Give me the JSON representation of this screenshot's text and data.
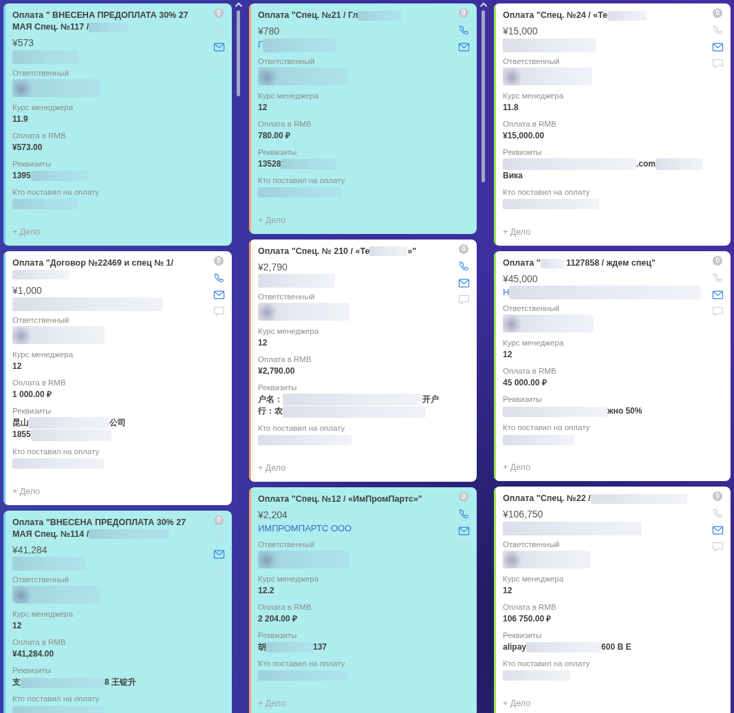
{
  "columns": [
    {
      "color": "#6fcbef",
      "scrollbar": true,
      "cards": [
        {
          "highlighted": true,
          "title": [
            {
              "kind": "text",
              "text": "Оплата \" ВНЕСЕНА ПРЕДОПЛАТА 30% 27 МАЯ Спец. №117 /"
            },
            {
              "kind": "redacted"
            }
          ],
          "badge": "0",
          "actions": [
            {
              "kind": "phone",
              "active": false
            },
            {
              "kind": "email",
              "active": true
            },
            {
              "kind": "chat",
              "active": false
            }
          ],
          "amount": "¥573",
          "company": [
            {
              "kind": "redacted"
            }
          ],
          "fields": [
            {
              "label": "Ответственный",
              "value": [
                {
                  "kind": "redacted"
                }
              ]
            },
            {
              "label": "Курс менеджера",
              "value": [
                {
                  "kind": "text",
                  "text": "11.9"
                }
              ]
            },
            {
              "label": "Оплата в RMB",
              "value": [
                {
                  "kind": "text",
                  "text": "¥573.00"
                }
              ]
            },
            {
              "label": "Реквизиты",
              "value": [
                {
                  "kind": "text",
                  "text": "1395"
                },
                {
                  "kind": "redacted"
                }
              ]
            },
            {
              "label": "Кто поставил на оплату",
              "value": [
                {
                  "kind": "redacted"
                }
              ]
            }
          ],
          "add_task": "+ Дело"
        },
        {
          "highlighted": false,
          "title": [
            {
              "kind": "text",
              "text": "Оплата \"Договор №22469 и спец № 1/"
            },
            {
              "kind": "break"
            },
            {
              "kind": "redacted"
            }
          ],
          "badge": "0",
          "actions": [
            {
              "kind": "phone",
              "active": true
            },
            {
              "kind": "email",
              "active": true
            },
            {
              "kind": "chat",
              "active": false
            }
          ],
          "amount": "¥1,000",
          "company": [
            {
              "kind": "redacted"
            }
          ],
          "fields": [
            {
              "label": "Ответственный",
              "value": [
                {
                  "kind": "redacted"
                }
              ]
            },
            {
              "label": "Курс менеджера",
              "value": [
                {
                  "kind": "text",
                  "text": "12"
                }
              ]
            },
            {
              "label": "Оплата в RMB",
              "value": [
                {
                  "kind": "text",
                  "text": "1 000.00 ₽"
                }
              ]
            },
            {
              "label": "Реквизиты",
              "value": [
                {
                  "kind": "text",
                  "text": "昆山"
                },
                {
                  "kind": "redacted"
                },
                {
                  "kind": "text",
                  "text": "公司"
                },
                {
                  "kind": "break"
                },
                {
                  "kind": "text",
                  "text": "1855"
                },
                {
                  "kind": "redacted"
                }
              ]
            },
            {
              "label": "Кто поставил на оплату",
              "value": [
                {
                  "kind": "redacted"
                }
              ]
            }
          ],
          "add_task": "+ Дело"
        },
        {
          "highlighted": true,
          "title": [
            {
              "kind": "text",
              "text": "Оплата \"ВНЕСЕНА ПРЕДОПЛАТА 30% 27 МАЯ Спец. №114 /"
            },
            {
              "kind": "redacted"
            }
          ],
          "badge": "0",
          "actions": [
            {
              "kind": "phone",
              "active": false
            },
            {
              "kind": "email",
              "active": true
            },
            {
              "kind": "chat",
              "active": false
            }
          ],
          "amount": "¥41,284",
          "company": [
            {
              "kind": "redacted"
            }
          ],
          "fields": [
            {
              "label": "Ответственный",
              "value": [
                {
                  "kind": "redacted"
                }
              ]
            },
            {
              "label": "Курс менеджера",
              "value": [
                {
                  "kind": "text",
                  "text": "12"
                }
              ]
            },
            {
              "label": "Оплата в RMB",
              "value": [
                {
                  "kind": "text",
                  "text": "¥41,284.00"
                }
              ]
            },
            {
              "label": "Реквизиты",
              "value": [
                {
                  "kind": "text",
                  "text": "支"
                },
                {
                  "kind": "redacted"
                },
                {
                  "kind": "text",
                  "text": "8 王锭升"
                }
              ]
            },
            {
              "label": "Кто поставил на оплату",
              "value": [
                {
                  "kind": "redacted"
                }
              ]
            }
          ]
        }
      ]
    },
    {
      "color": "#f4a36c",
      "scrollbar": true,
      "cards": [
        {
          "highlighted": true,
          "title": [
            {
              "kind": "text",
              "text": "Оплата \"Спец. №21 / Гл"
            },
            {
              "kind": "redacted"
            }
          ],
          "badge": "0",
          "actions": [
            {
              "kind": "phone",
              "active": true
            },
            {
              "kind": "email",
              "active": true
            },
            {
              "kind": "chat",
              "active": false
            }
          ],
          "amount": "¥780",
          "company": [
            {
              "kind": "text",
              "text": "Г"
            },
            {
              "kind": "redacted"
            }
          ],
          "fields": [
            {
              "label": "Ответственный",
              "value": [
                {
                  "kind": "redacted"
                }
              ]
            },
            {
              "label": "Курс менеджера",
              "value": [
                {
                  "kind": "text",
                  "text": "12"
                }
              ]
            },
            {
              "label": "Оплата в RMB",
              "value": [
                {
                  "kind": "text",
                  "text": "780.00 ₽"
                }
              ]
            },
            {
              "label": "Реквизиты",
              "value": [
                {
                  "kind": "text",
                  "text": "13528"
                },
                {
                  "kind": "redacted"
                }
              ]
            },
            {
              "label": "Кто поставил на оплату",
              "value": [
                {
                  "kind": "redacted"
                }
              ]
            }
          ],
          "add_task": "+ Дело"
        },
        {
          "highlighted": false,
          "title": [
            {
              "kind": "text",
              "text": "Оплата \"Спец. № 210 / «Те"
            },
            {
              "kind": "redacted"
            },
            {
              "kind": "text",
              "text": "»\""
            }
          ],
          "badge": "0",
          "actions": [
            {
              "kind": "phone",
              "active": true
            },
            {
              "kind": "email",
              "active": true
            },
            {
              "kind": "chat",
              "active": false
            }
          ],
          "amount": "¥2,790",
          "company": [
            {
              "kind": "redacted"
            }
          ],
          "fields": [
            {
              "label": "Ответственный",
              "value": [
                {
                  "kind": "redacted"
                }
              ]
            },
            {
              "label": "Курс менеджера",
              "value": [
                {
                  "kind": "text",
                  "text": "12"
                }
              ]
            },
            {
              "label": "Оплата в RMB",
              "value": [
                {
                  "kind": "text",
                  "text": "¥2,790.00"
                }
              ]
            },
            {
              "label": "Реквизиты",
              "value": [
                {
                  "kind": "text",
                  "text": "户名："
                },
                {
                  "kind": "redacted"
                },
                {
                  "kind": "text",
                  "text": "开户"
                },
                {
                  "kind": "break"
                },
                {
                  "kind": "text",
                  "text": "行：农"
                },
                {
                  "kind": "redacted"
                }
              ]
            },
            {
              "label": "Кто поставил на оплату",
              "value": [
                {
                  "kind": "redacted"
                }
              ]
            }
          ],
          "add_task": "+ Дело"
        },
        {
          "highlighted": true,
          "title": [
            {
              "kind": "text",
              "text": "Оплата \"Спец. №12 / «ИмПромПартс»\""
            }
          ],
          "badge": "0",
          "actions": [
            {
              "kind": "phone",
              "active": true
            },
            {
              "kind": "email",
              "active": true
            },
            {
              "kind": "chat",
              "active": false
            }
          ],
          "amount": "¥2,204",
          "company": [
            {
              "kind": "text",
              "text": "ИМПРОМПАРТС ООО"
            }
          ],
          "fields": [
            {
              "label": "Ответственный",
              "value": [
                {
                  "kind": "redacted"
                }
              ]
            },
            {
              "label": "Курс менеджера",
              "value": [
                {
                  "kind": "text",
                  "text": "12.2"
                }
              ]
            },
            {
              "label": "Оплата в RMB",
              "value": [
                {
                  "kind": "text",
                  "text": "2 204.00 ₽"
                }
              ]
            },
            {
              "label": "Реквизиты",
              "value": [
                {
                  "kind": "text",
                  "text": "胡"
                },
                {
                  "kind": "redacted"
                },
                {
                  "kind": "text",
                  "text": "137"
                }
              ]
            },
            {
              "label": "Кто поставил на оплату",
              "value": [
                {
                  "kind": "redacted"
                }
              ]
            }
          ],
          "add_task": "+ Дело"
        }
      ]
    },
    {
      "color": "#9fe650",
      "cards": [
        {
          "highlighted": false,
          "title": [
            {
              "kind": "text",
              "text": "Оплата \"Спец. №24 / «Те"
            },
            {
              "kind": "redacted"
            }
          ],
          "badge": "0",
          "actions": [
            {
              "kind": "phone",
              "active": false
            },
            {
              "kind": "email",
              "active": true
            },
            {
              "kind": "chat",
              "active": false
            }
          ],
          "amount": "¥15,000",
          "company": [
            {
              "kind": "redacted"
            }
          ],
          "fields": [
            {
              "label": "Ответственный",
              "value": [
                {
                  "kind": "redacted"
                }
              ]
            },
            {
              "label": "Курс менеджера",
              "value": [
                {
                  "kind": "text",
                  "text": "11.8"
                }
              ]
            },
            {
              "label": "Оплата в RMB",
              "value": [
                {
                  "kind": "text",
                  "text": "¥15,000.00"
                }
              ]
            },
            {
              "label": "Реквизиты",
              "value": [
                {
                  "kind": "redacted"
                },
                {
                  "kind": "text",
                  "text": ".com"
                },
                {
                  "kind": "redacted"
                },
                {
                  "kind": "break"
                },
                {
                  "kind": "text",
                  "text": "Вика"
                }
              ]
            },
            {
              "label": "Кто поставил на оплату",
              "value": [
                {
                  "kind": "redacted"
                }
              ]
            }
          ],
          "add_task": "+ Дело"
        },
        {
          "highlighted": false,
          "title": [
            {
              "kind": "text",
              "text": "Оплата \""
            },
            {
              "kind": "redacted"
            },
            {
              "kind": "text",
              "text": " 1127858 / ждем спец\""
            }
          ],
          "badge": "0",
          "actions": [
            {
              "kind": "phone",
              "active": false
            },
            {
              "kind": "email",
              "active": true
            },
            {
              "kind": "chat",
              "active": false
            }
          ],
          "amount": "¥45,000",
          "company": [
            {
              "kind": "text",
              "text": "Н"
            },
            {
              "kind": "redacted"
            }
          ],
          "fields": [
            {
              "label": "Ответственный",
              "value": [
                {
                  "kind": "redacted"
                }
              ]
            },
            {
              "label": "Курс менеджера",
              "value": [
                {
                  "kind": "text",
                  "text": "12"
                }
              ]
            },
            {
              "label": "Оплата в RMB",
              "value": [
                {
                  "kind": "text",
                  "text": "45 000.00 ₽"
                }
              ]
            },
            {
              "label": "Реквизиты",
              "value": [
                {
                  "kind": "redacted"
                },
                {
                  "kind": "text",
                  "text": "жно 50%"
                }
              ]
            },
            {
              "label": "Кто поставил на оплату",
              "value": [
                {
                  "kind": "redacted"
                }
              ]
            }
          ],
          "add_task": "+ Дело"
        },
        {
          "highlighted": false,
          "title": [
            {
              "kind": "text",
              "text": "Оплата \"Спец. №22 /"
            },
            {
              "kind": "redacted"
            }
          ],
          "badge": "0",
          "actions": [
            {
              "kind": "phone",
              "active": false
            },
            {
              "kind": "email",
              "active": true
            },
            {
              "kind": "chat",
              "active": false
            }
          ],
          "amount": "¥106,750",
          "company": [
            {
              "kind": "redacted"
            }
          ],
          "fields": [
            {
              "label": "Ответственный",
              "value": [
                {
                  "kind": "redacted"
                }
              ]
            },
            {
              "label": "Курс менеджера",
              "value": [
                {
                  "kind": "text",
                  "text": "12"
                }
              ]
            },
            {
              "label": "Оплата в RMB",
              "value": [
                {
                  "kind": "text",
                  "text": "106 750.00 ₽"
                }
              ]
            },
            {
              "label": "Реквизиты",
              "value": [
                {
                  "kind": "text",
                  "text": "alipay"
                },
                {
                  "kind": "redacted"
                },
                {
                  "kind": "text",
                  "text": "600 B E"
                }
              ]
            },
            {
              "label": "Кто поставил на оплату",
              "value": [
                {
                  "kind": "redacted"
                }
              ]
            }
          ],
          "add_task": "+ Дело"
        }
      ]
    }
  ]
}
